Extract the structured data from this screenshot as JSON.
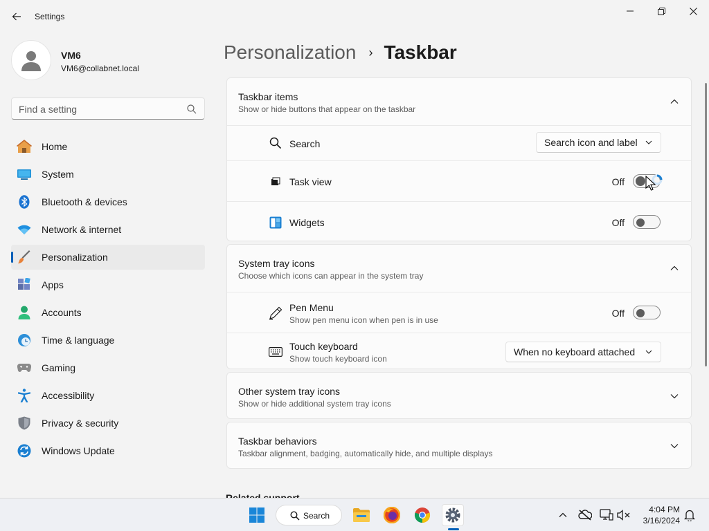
{
  "window": {
    "title": "Settings"
  },
  "user": {
    "name": "VM6",
    "email": "VM6@collabnet.local"
  },
  "search": {
    "placeholder": "Find a setting"
  },
  "nav": {
    "items": [
      {
        "label": "Home",
        "icon": "home-icon"
      },
      {
        "label": "System",
        "icon": "system-icon"
      },
      {
        "label": "Bluetooth & devices",
        "icon": "bluetooth-icon"
      },
      {
        "label": "Network & internet",
        "icon": "wifi-icon"
      },
      {
        "label": "Personalization",
        "icon": "paintbrush-icon",
        "selected": true
      },
      {
        "label": "Apps",
        "icon": "apps-icon"
      },
      {
        "label": "Accounts",
        "icon": "accounts-icon"
      },
      {
        "label": "Time & language",
        "icon": "clock-globe-icon"
      },
      {
        "label": "Gaming",
        "icon": "gamepad-icon"
      },
      {
        "label": "Accessibility",
        "icon": "accessibility-icon"
      },
      {
        "label": "Privacy & security",
        "icon": "shield-icon"
      },
      {
        "label": "Windows Update",
        "icon": "update-icon"
      }
    ]
  },
  "breadcrumb": {
    "parent": "Personalization",
    "separator": "›",
    "current": "Taskbar"
  },
  "taskbar_items": {
    "title": "Taskbar items",
    "subtitle": "Show or hide buttons that appear on the taskbar",
    "search": {
      "label": "Search",
      "value": "Search icon and label"
    },
    "task_view": {
      "label": "Task view",
      "state": "Off"
    },
    "widgets": {
      "label": "Widgets",
      "state": "Off"
    }
  },
  "system_tray": {
    "title": "System tray icons",
    "subtitle": "Choose which icons can appear in the system tray",
    "pen_menu": {
      "label": "Pen Menu",
      "subtitle": "Show pen menu icon when pen is in use",
      "state": "Off"
    },
    "touch_keyboard": {
      "label": "Touch keyboard",
      "subtitle": "Show touch keyboard icon",
      "value": "When no keyboard attached"
    }
  },
  "other_tray": {
    "title": "Other system tray icons",
    "subtitle": "Show or hide additional system tray icons"
  },
  "behaviors": {
    "title": "Taskbar behaviors",
    "subtitle": "Taskbar alignment, badging, automatically hide, and multiple displays"
  },
  "related": {
    "title": "Related support"
  },
  "os_taskbar": {
    "search_label": "Search",
    "time": "4:04 PM",
    "date": "3/16/2024"
  },
  "colors": {
    "accent": "#005fb8",
    "background": "#f3f3f3",
    "card": "#fbfbfb"
  }
}
